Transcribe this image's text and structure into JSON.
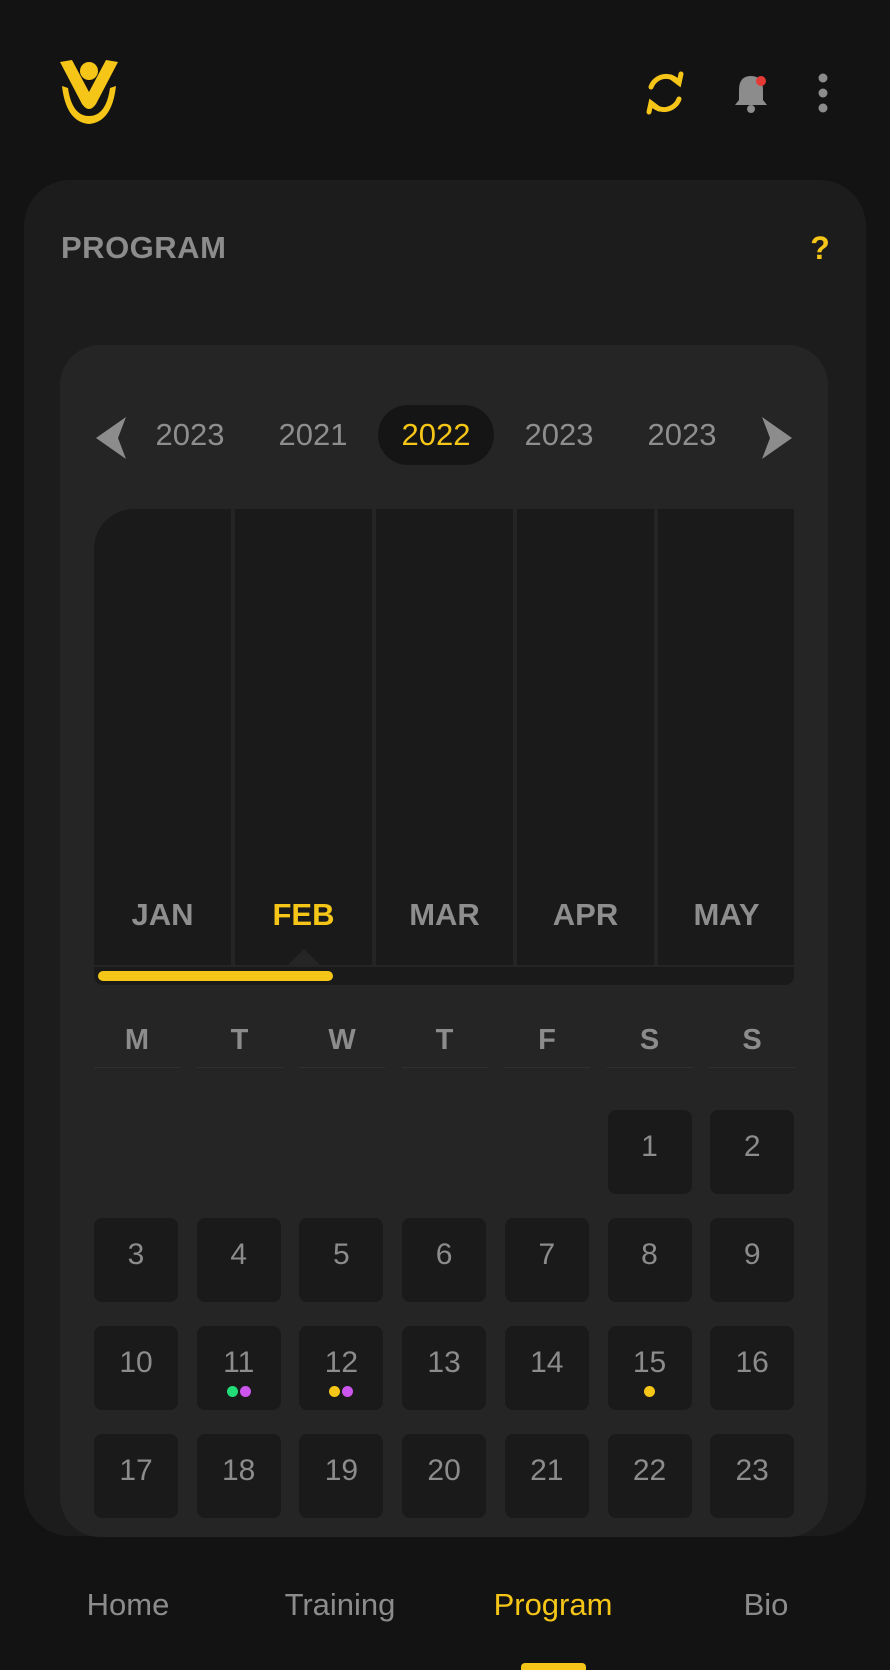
{
  "card": {
    "title": "PROGRAM",
    "help_label": "?"
  },
  "years": [
    "2023",
    "2021",
    "2022",
    "2023",
    "2023"
  ],
  "active_year_index": 2,
  "months": [
    "JAN",
    "FEB",
    "MAR",
    "APR",
    "MAY"
  ],
  "active_month_index": 1,
  "month_progress": 0.34,
  "weekdays": [
    "M",
    "T",
    "W",
    "T",
    "F",
    "S",
    "S"
  ],
  "days": [
    {
      "n": "1",
      "dots": []
    },
    {
      "n": "2",
      "dots": []
    },
    {
      "n": "3",
      "dots": []
    },
    {
      "n": "4",
      "dots": []
    },
    {
      "n": "5",
      "dots": []
    },
    {
      "n": "6",
      "dots": []
    },
    {
      "n": "7",
      "dots": []
    },
    {
      "n": "8",
      "dots": []
    },
    {
      "n": "9",
      "dots": []
    },
    {
      "n": "10",
      "dots": []
    },
    {
      "n": "11",
      "dots": [
        "#22dd77",
        "#cc55ee"
      ]
    },
    {
      "n": "12",
      "dots": [
        "#f5c518",
        "#cc55ee"
      ]
    },
    {
      "n": "13",
      "dots": []
    },
    {
      "n": "14",
      "dots": []
    },
    {
      "n": "15",
      "dots": [
        "#f5c518"
      ]
    },
    {
      "n": "16",
      "dots": []
    },
    {
      "n": "17",
      "dots": []
    },
    {
      "n": "18",
      "dots": []
    },
    {
      "n": "19",
      "dots": []
    },
    {
      "n": "20",
      "dots": []
    },
    {
      "n": "21",
      "dots": []
    },
    {
      "n": "22",
      "dots": []
    },
    {
      "n": "23",
      "dots": []
    }
  ],
  "nav": {
    "items": [
      "Home",
      "Training",
      "Program",
      "Bio"
    ],
    "active_index": 2
  },
  "colors": {
    "accent": "#f5c518",
    "notification_dot": "#e53935",
    "dot_green": "#22dd77",
    "dot_purple": "#cc55ee"
  },
  "icons": {
    "logo": "person-v-logo",
    "refresh": "refresh-icon",
    "bell": "bell-icon",
    "more": "more-vertical-icon",
    "prev": "chevron-left-icon",
    "next": "chevron-right-icon"
  }
}
